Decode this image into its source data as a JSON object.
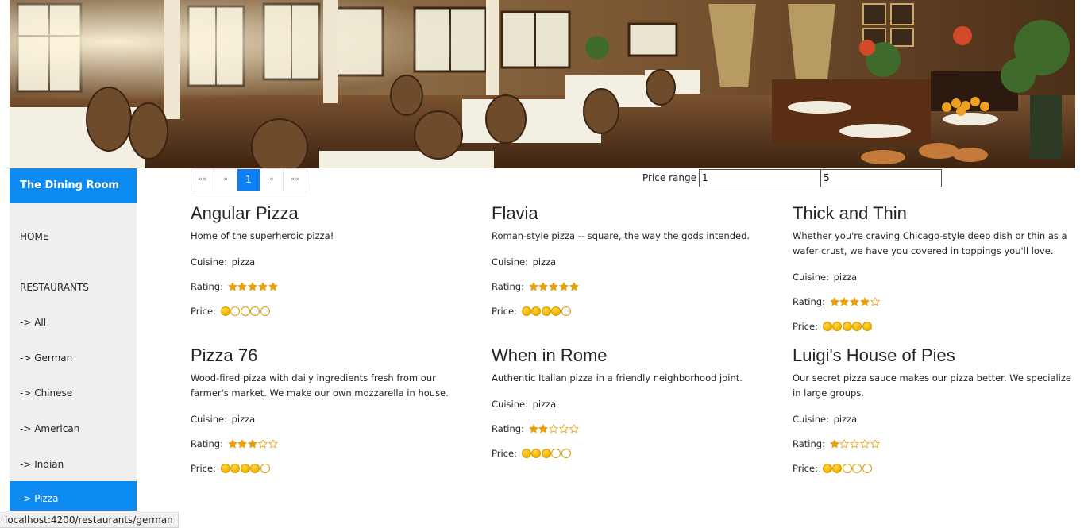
{
  "sidebar": {
    "brand": "The Dining Room",
    "items": [
      {
        "label": "HOME",
        "active": false
      },
      {
        "label": "RESTAURANTS",
        "active": false
      },
      {
        "label": "-> All",
        "active": false
      },
      {
        "label": "-> German",
        "active": false
      },
      {
        "label": "-> Chinese",
        "active": false
      },
      {
        "label": "-> American",
        "active": false
      },
      {
        "label": "-> Indian",
        "active": false
      },
      {
        "label": "-> Pizza",
        "active": true
      }
    ]
  },
  "pagination": {
    "first": "««",
    "prev": "«",
    "current": "1",
    "next": "»",
    "last": "»»"
  },
  "price_range": {
    "label": "Price range",
    "min": "1",
    "max": "5"
  },
  "labels": {
    "cuisine": "Cuisine:",
    "rating": "Rating:",
    "price": "Price:"
  },
  "restaurants": [
    {
      "name": "Angular Pizza",
      "description": "Home of the superheroic pizza!",
      "cuisine": "pizza",
      "rating": 5,
      "price": 1
    },
    {
      "name": "Flavia",
      "description": "Roman-style pizza -- square, the way the gods intended.",
      "cuisine": "pizza",
      "rating": 5,
      "price": 4
    },
    {
      "name": "Thick and Thin",
      "description": "Whether you're craving Chicago-style deep dish or thin as a wafer crust, we have you covered in toppings you'll love.",
      "cuisine": "pizza",
      "rating": 4,
      "price": 5
    },
    {
      "name": "Pizza 76",
      "description": "Wood-fired pizza with daily ingredients fresh from our farmer's market. We make our own mozzarella in house.",
      "cuisine": "pizza",
      "rating": 3,
      "price": 4
    },
    {
      "name": "When in Rome",
      "description": "Authentic Italian pizza in a friendly neighborhood joint.",
      "cuisine": "pizza",
      "rating": 2,
      "price": 3
    },
    {
      "name": "Luigi's House of Pies",
      "description": "Our secret pizza sauce makes our pizza better. We specialize in large groups.",
      "cuisine": "pizza",
      "rating": 1,
      "price": 2
    }
  ],
  "status_bar": "localhost:4200/restaurants/german",
  "colors": {
    "accent": "#0d8bf0",
    "sidebar_bg": "#efefef",
    "star": "#e8a10b",
    "coin": "#f2b600"
  },
  "icons": {
    "star": "star-icon",
    "coin": "price-coin-icon"
  }
}
